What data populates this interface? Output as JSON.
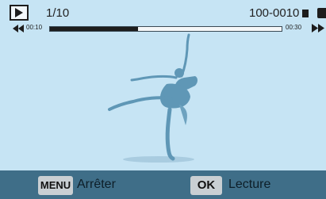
{
  "top": {
    "counter": "1/10",
    "file_number": "100-0010",
    "time_start": "00:10",
    "time_end": "00:30",
    "progress": 0.38
  },
  "bottom": {
    "menu_key": "MENU",
    "stop_label": "Arrêter",
    "ok_key": "OK",
    "play_label": "Lecture"
  },
  "icons": {
    "mode": "play-mode-icon",
    "rewind": "rewind-icon",
    "fast_forward": "fast-forward-icon",
    "memory_card": "memory-card-icon",
    "battery": "battery-icon"
  },
  "colors": {
    "screen_bg": "#c6e4f4",
    "bar_bg": "#3f6e88",
    "silhouette": "#5f97b6"
  }
}
